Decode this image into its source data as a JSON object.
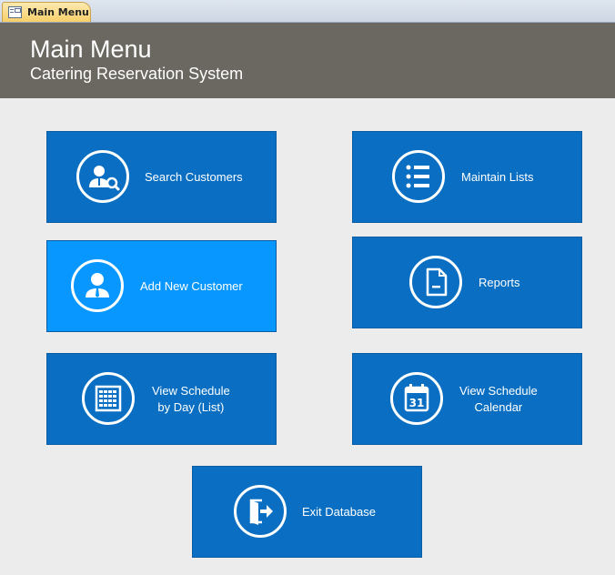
{
  "tab": {
    "label": "Main Menu"
  },
  "header": {
    "title": "Main Menu",
    "subtitle": "Catering Reservation System"
  },
  "buttons": {
    "search_customers": "Search Customers",
    "maintain_lists": "Maintain Lists",
    "add_new_customer": "Add New Customer",
    "reports": "Reports",
    "view_schedule_day_line1": "View Schedule",
    "view_schedule_day_line2": "by Day (List)",
    "view_schedule_cal_line1": "View Schedule",
    "view_schedule_cal_line2": "Calendar",
    "exit_database": "Exit Database"
  },
  "calendar_icon_day": "31",
  "colors": {
    "button": "#0a6fc2",
    "button_active": "#0897ff",
    "header": "#6b6761",
    "background": "#ececec"
  }
}
